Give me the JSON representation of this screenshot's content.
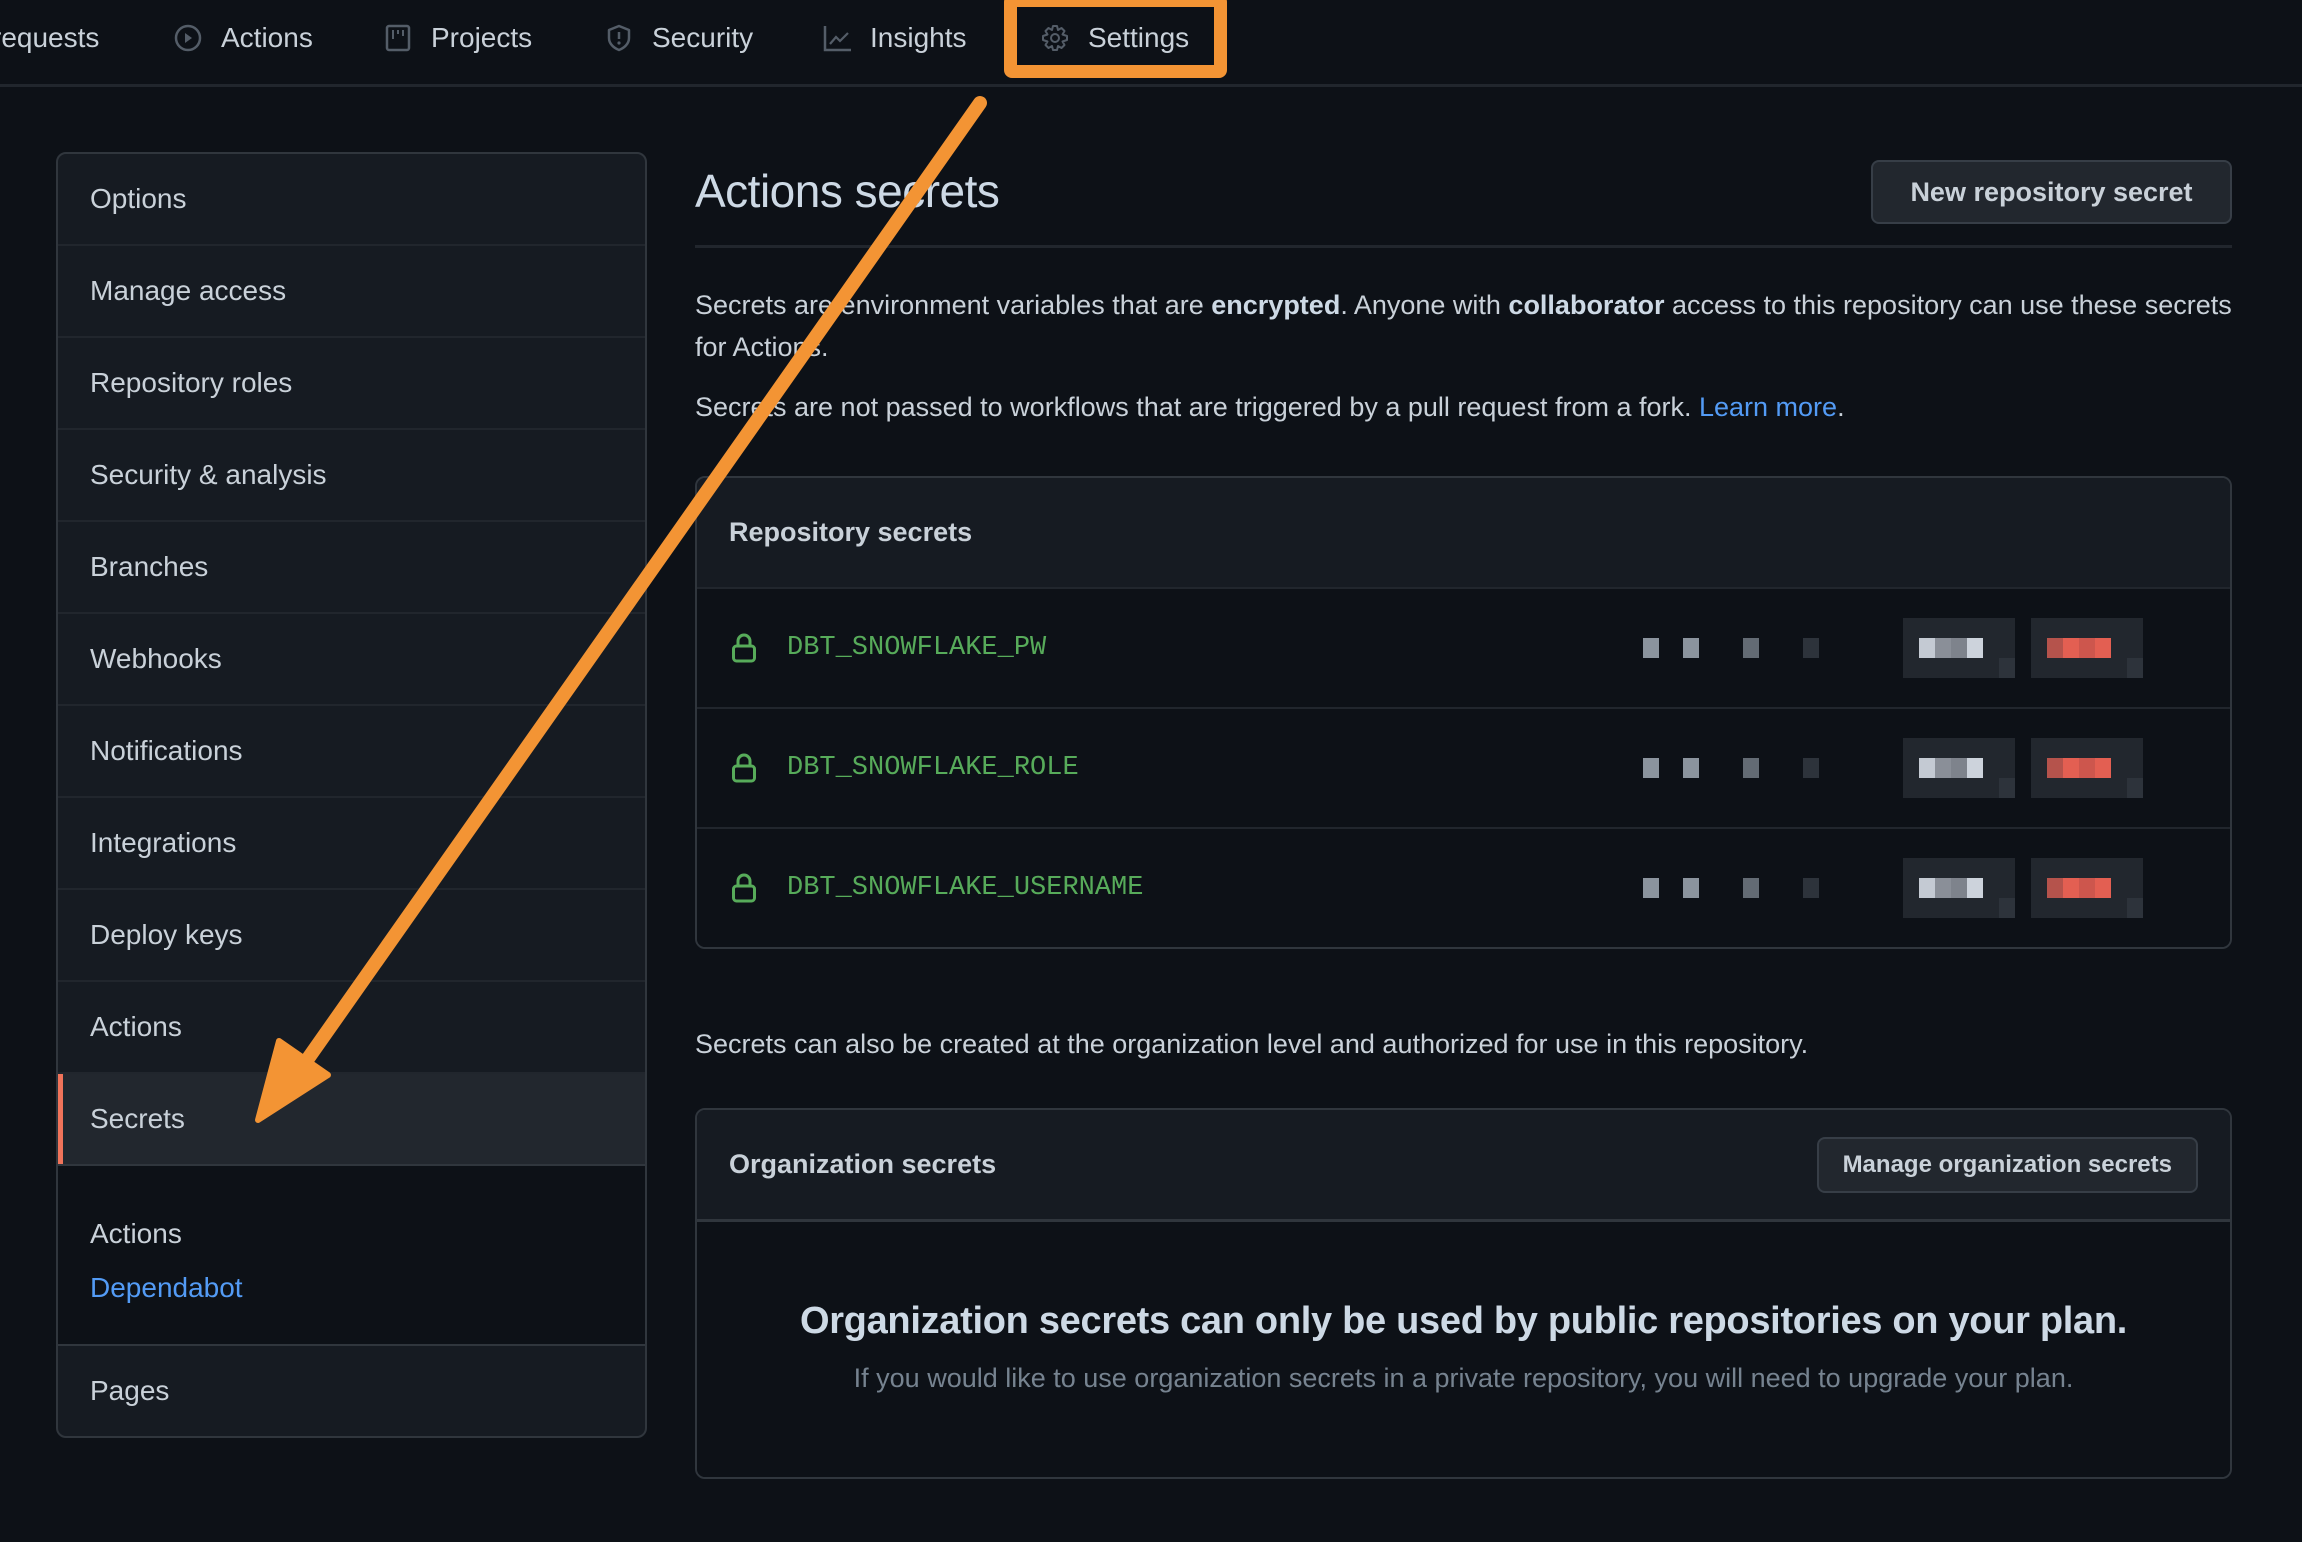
{
  "nav": {
    "tabs": [
      {
        "label": "requests",
        "icon": "pull-request-icon"
      },
      {
        "label": "Actions",
        "icon": "play-circle-icon"
      },
      {
        "label": "Projects",
        "icon": "project-board-icon"
      },
      {
        "label": "Security",
        "icon": "shield-icon"
      },
      {
        "label": "Insights",
        "icon": "graph-icon"
      },
      {
        "label": "Settings",
        "icon": "gear-icon",
        "active": true
      }
    ]
  },
  "sidebar": {
    "items": [
      {
        "label": "Options"
      },
      {
        "label": "Manage access"
      },
      {
        "label": "Repository roles"
      },
      {
        "label": "Security & analysis"
      },
      {
        "label": "Branches"
      },
      {
        "label": "Webhooks"
      },
      {
        "label": "Notifications"
      },
      {
        "label": "Integrations"
      },
      {
        "label": "Deploy keys"
      },
      {
        "label": "Actions"
      },
      {
        "label": "Secrets",
        "selected": true
      }
    ],
    "subgroup": {
      "title": "Actions",
      "link": "Dependabot"
    },
    "last_item": "Pages"
  },
  "main": {
    "title": "Actions secrets",
    "new_secret_button": "New repository secret",
    "description1": {
      "part1": "Secrets are environment variables that are ",
      "bold1": "encrypted",
      "part2": ". Anyone with ",
      "bold2": "collaborator",
      "part3": " access to this repository can use these secrets for Actions."
    },
    "description2": {
      "text": "Secrets are not passed to workflows that are triggered by a pull request from a fork. ",
      "link": "Learn more",
      "end": "."
    },
    "repo_secrets": {
      "header": "Repository secrets",
      "rows": [
        {
          "name": "DBT_SNOWFLAKE_PW"
        },
        {
          "name": "DBT_SNOWFLAKE_ROLE"
        },
        {
          "name": "DBT_SNOWFLAKE_USERNAME"
        }
      ]
    },
    "org_text": "Secrets can also be created at the organization level and authorized for use in this repository.",
    "org_secrets": {
      "header": "Organization secrets",
      "manage_button": "Manage organization secrets",
      "blankslate_title": "Organization secrets can only be used by public repositories on your plan.",
      "blankslate_text": "If you would like to use organization secrets in a private repository, you will need to upgrade your plan."
    }
  },
  "colors": {
    "background": "#0d1117",
    "annotation": "#f39434",
    "secret_green": "#57ab5a",
    "link_blue": "#539bf5",
    "selected_marker": "#f0735a"
  }
}
